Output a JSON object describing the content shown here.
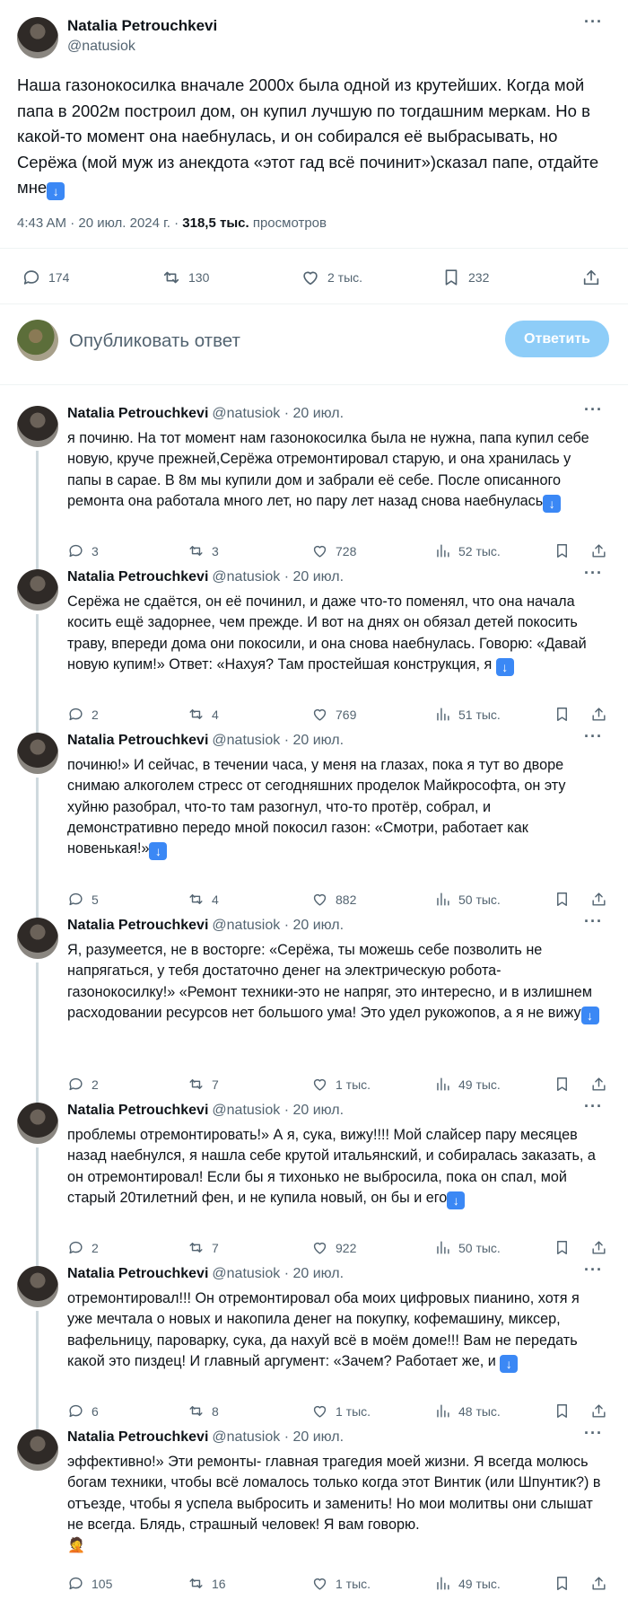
{
  "main_tweet": {
    "author_name": "Natalia Petrouchkevi",
    "author_handle": "@natusiok",
    "text": "Наша газонокосилка вначале 2000х была одной из крутейших. Когда мой папа в 2002м построил дом, он купил лучшую по тогдашним меркам. Но в какой-то момент она наебнулась, и он собирался её выбрасывать, но Серёжа (мой муж из анекдота «этот гад всё починит»)сказал папе, отдайте мне",
    "time": "4:43 AM · 20 июл. 2024 г. · ",
    "views_count": "318,5 тыс.",
    "views_label": "просмотров",
    "replies": "174",
    "retweets": "130",
    "likes": "2 тыс.",
    "bookmarks": "232"
  },
  "reply_box": {
    "placeholder": "Опубликовать ответ",
    "button_label": "Ответить"
  },
  "thread": [
    {
      "name": "Natalia Petrouchkevi",
      "meta": "@natusiok · 20 июл.",
      "text": "я починю.  На тот момент нам газонокосилка была не нужна, папа купил себе новую, круче прежней,Серёжа отремонтировал старую, и она хранилась у папы в сарае. В 8м мы купили дом и забрали её себе. После описанного ремонта она работала много лет, но пару лет назад снова наебнулась",
      "replies": "3",
      "retweets": "3",
      "likes": "728",
      "views": "52 тыс."
    },
    {
      "name": "Natalia Petrouchkevi",
      "meta": "@natusiok · 20 июл.",
      "text": "Серёжа не сдаётся, он её починил, и даже что-то поменял, что она начала косить ещё задорнее, чем прежде. И вот на днях он обязал детей покосить траву, впереди дома они покосили, и она снова наебнулась. Говорю: «Давай новую купим!» Ответ: «Нахуя? Там простейшая конструкция, я",
      "replies": "2",
      "retweets": "4",
      "likes": "769",
      "views": "51 тыс."
    },
    {
      "name": "Natalia Petrouchkevi",
      "meta": "@natusiok · 20 июл.",
      "text": "починю!» И сейчас, в течении часа, у меня на глазах, пока я тут во дворе снимаю алкоголем стресс от сегодняшних проделок Майкрософта, он эту хуйню разобрал, что-то там разогнул, что-то протёр, собрал, и демонстративно передо мной покосил газон: «Смотри, работает как новенькая!»",
      "replies": "5",
      "retweets": "4",
      "likes": "882",
      "views": "50 тыс."
    },
    {
      "name": "Natalia Petrouchkevi",
      "meta": "@natusiok · 20 июл.",
      "text": "Я, разумеется, не в восторге: «Серёжа, ты можешь себе позволить не напрягаться, у тебя достаточно денег на электрическую робота- газонокосилку!» «Ремонт техники-это не напряг, это интересно, и в излишнем расходовании ресурсов нет большого ума! Это удел рукожопов, а я не вижу",
      "replies": "2",
      "retweets": "7",
      "likes": "1 тыс.",
      "views": "49 тыс."
    },
    {
      "name": "Natalia Petrouchkevi",
      "meta": "@natusiok · 20 июл.",
      "text": "проблемы отремонтировать!» А я, сука, вижу!!!! Мой слайсер пару месяцев назад наебнулся, я нашла себе крутой итальянский, и собиралась заказать, а он отремонтировал! Если бы я тихонько не выбросила, пока он спал, мой старый 20тилетний фен, и не купила новый, он бы и его",
      "replies": "2",
      "retweets": "7",
      "likes": "922",
      "views": "50 тыс."
    },
    {
      "name": "Natalia Petrouchkevi",
      "meta": "@natusiok · 20 июл.",
      "text": "отремонтировал!!! Он отремонтировал оба моих цифровых пианино, хотя я уже мечтала о новых и накопила денег на покупку, кофемашину, миксер, вафельницу, пароварку, сука, да нахуй всё в моём доме!!! Вам не передать какой это пиздец! И главный аргумент: «Зачем? Работает же, и",
      "replies": "6",
      "retweets": "8",
      "likes": "1 тыс.",
      "views": "48 тыс."
    },
    {
      "name": "Natalia Petrouchkevi",
      "meta": "@natusiok · 20 июл.",
      "text": "эффективно!» Эти ремонты- главная трагедия моей жизни. Я всегда молюсь богам техники, чтобы всё ломалось только когда этот Винтик (или Шпунтик?) в отъезде, чтобы я успела выбросить и заменить! Но мои молитвы они слышат не всегда. Блядь, страшный человек! Я вам говорю.",
      "replies": "105",
      "retweets": "16",
      "likes": "1 тыс.",
      "views": "49 тыс."
    }
  ]
}
